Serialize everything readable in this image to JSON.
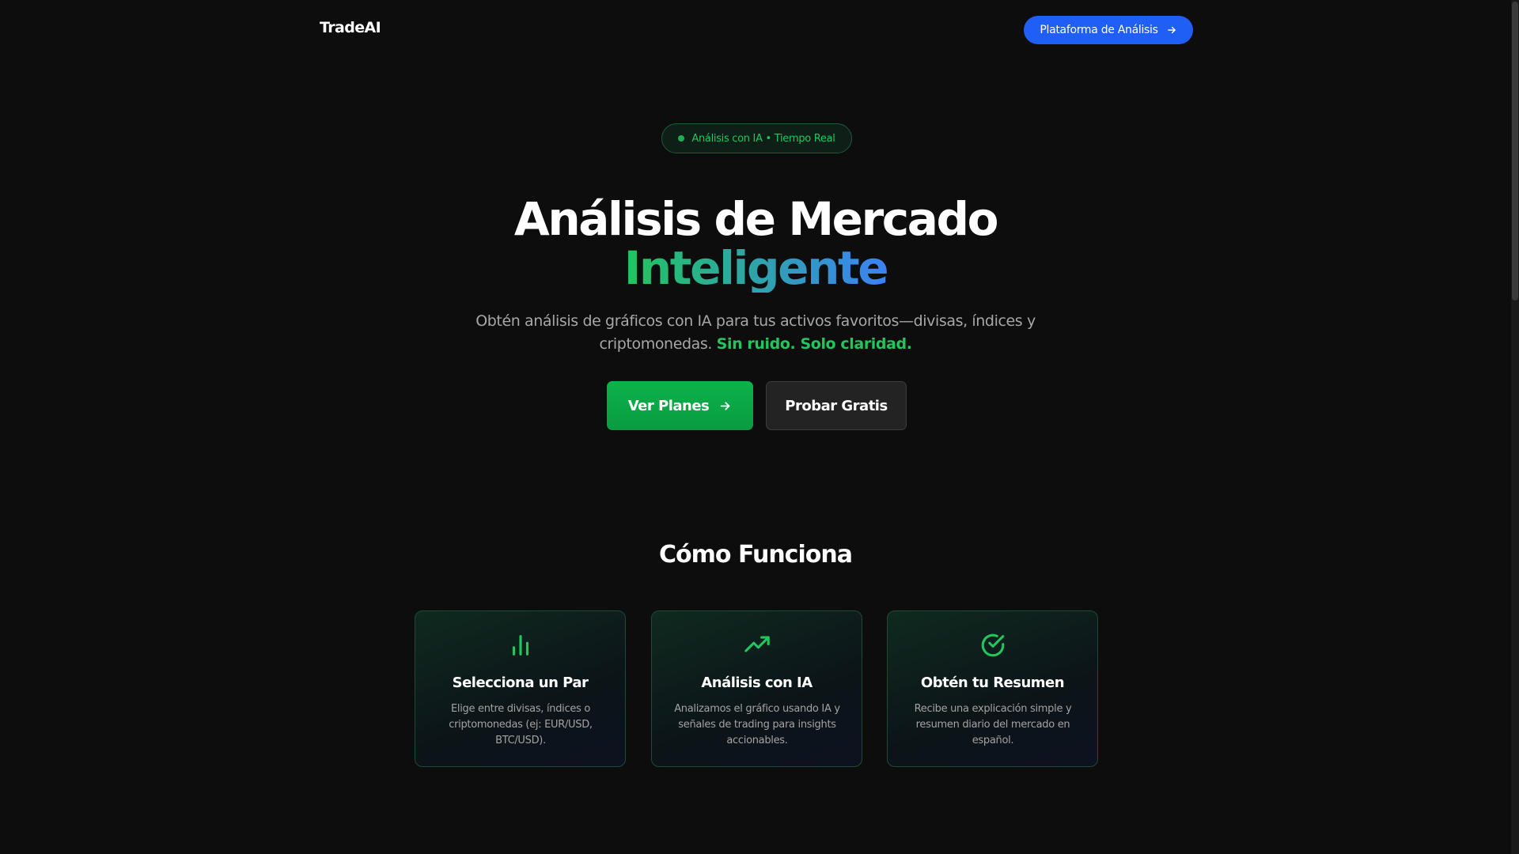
{
  "nav": {
    "logo": "TradeAI",
    "platform_button": "Plataforma de Análisis"
  },
  "badge": {
    "text": "Análisis con IA • Tiempo Real"
  },
  "hero": {
    "title_line1": "Análisis de Mercado",
    "title_line2": "Inteligente",
    "subtitle_main": "Obtén análisis de gráficos con IA para tus activos favoritos—divisas, índices y criptomonedas.",
    "subtitle_accent": "Sin ruido. Solo claridad.",
    "cta_primary": "Ver Planes",
    "cta_secondary": "Probar Gratis"
  },
  "how_it_works": {
    "title": "Cómo Funciona",
    "cards": [
      {
        "icon": "bar-chart-icon",
        "title": "Selecciona un Par",
        "description": "Elige entre divisas, índices o criptomonedas (ej: EUR/USD, BTC/USD)."
      },
      {
        "icon": "trending-up-icon",
        "title": "Análisis con IA",
        "description": "Analizamos el gráfico usando IA y señales de trading para insights accionables."
      },
      {
        "icon": "check-circle-icon",
        "title": "Obtén tu Resumen",
        "description": "Recibe una explicación simple y resumen diario del mercado en español."
      }
    ]
  },
  "colors": {
    "background": "#0d0d0d",
    "brand_blue": "#1f5ff5",
    "accent_green": "#22c55e",
    "cta_green": "#0bb24a",
    "gradient_end_blue": "#3b82f6"
  }
}
